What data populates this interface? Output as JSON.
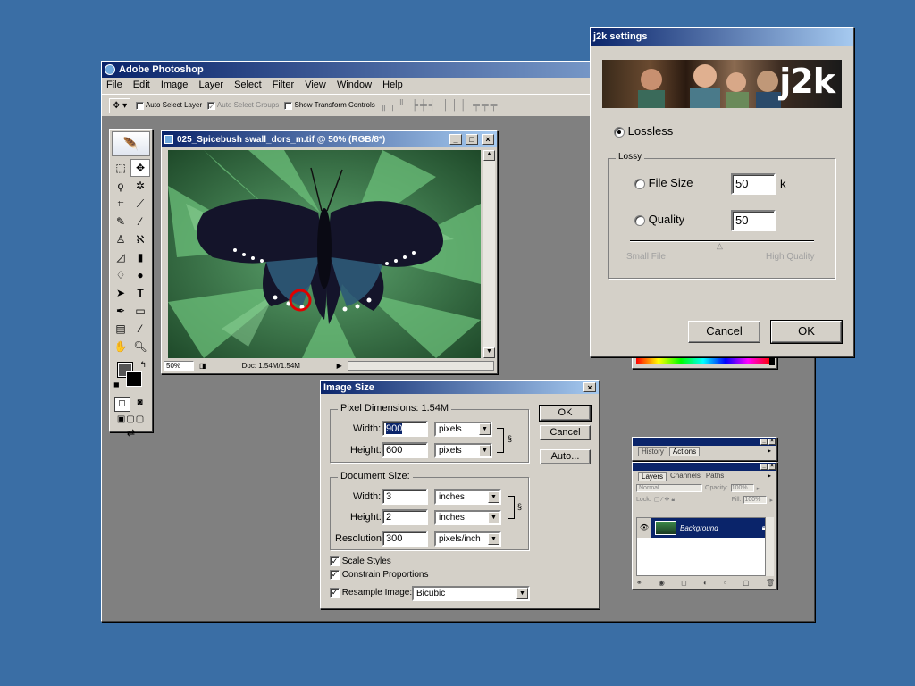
{
  "photoshop": {
    "title": "Adobe Photoshop",
    "menu": [
      "File",
      "Edit",
      "Image",
      "Layer",
      "Select",
      "Filter",
      "View",
      "Window",
      "Help"
    ],
    "options": {
      "auto_select_layer": "Auto Select Layer",
      "auto_select_groups": "Auto Select Groups",
      "show_transform_controls": "Show Transform Controls"
    }
  },
  "document": {
    "title": "025_Spicebush swall_dors_m.tif @ 50% (RGB/8*)",
    "zoom": "50%",
    "doc_info": "Doc: 1.54M/1.54M"
  },
  "image_size": {
    "title": "Image Size",
    "pixel_dimensions_label": "Pixel Dimensions:",
    "pixel_dimensions_value": "1.54M",
    "width_label": "Width:",
    "width_value": "900",
    "width_unit": "pixels",
    "height_label": "Height:",
    "height_value": "600",
    "height_unit": "pixels",
    "document_size_label": "Document Size:",
    "doc_width_label": "Width:",
    "doc_width_value": "3",
    "doc_width_unit": "inches",
    "doc_height_label": "Height:",
    "doc_height_value": "2",
    "doc_height_unit": "inches",
    "resolution_label": "Resolution:",
    "resolution_value": "300",
    "resolution_unit": "pixels/inch",
    "scale_styles": "Scale Styles",
    "constrain_proportions": "Constrain Proportions",
    "resample_image": "Resample Image:",
    "resample_method": "Bicubic",
    "ok": "OK",
    "cancel": "Cancel",
    "auto": "Auto..."
  },
  "j2k": {
    "title": "j2k settings",
    "banner_text": "j2k",
    "lossless": "Lossless",
    "lossy": "Lossy",
    "file_size": "File Size",
    "file_size_value": "50",
    "file_size_unit": "k",
    "quality": "Quality",
    "quality_value": "50",
    "small_file": "Small File",
    "high_quality": "High Quality",
    "cancel": "Cancel",
    "ok": "OK"
  },
  "palettes": {
    "history_tab": "History",
    "actions_tab": "Actions",
    "layers_tab": "Layers",
    "channels_tab": "Channels",
    "paths_tab": "Paths",
    "blend_mode": "Normal",
    "opacity_label": "Opacity:",
    "opacity_value": "100%",
    "lock_label": "Lock:",
    "fill_label": "Fill:",
    "fill_value": "100%",
    "layer_name": "Background"
  },
  "colors": {
    "desktop": "#3a6ea5",
    "titlebar": "#0a246a",
    "selection": "#0a246a",
    "annotation_circle": "#e00000"
  }
}
